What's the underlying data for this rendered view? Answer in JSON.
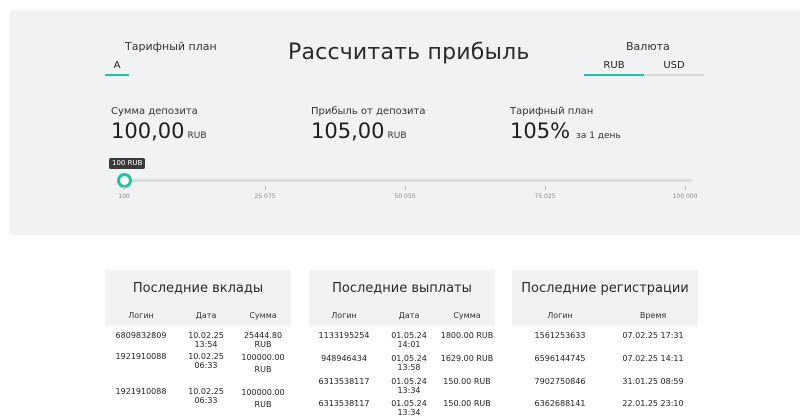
{
  "header": {
    "plan_label": "Тарифный план",
    "plan_tab": "A",
    "title": "Рассчитать прибыль",
    "currency_label": "Валюта",
    "currency_tabs": [
      "RUB",
      "USD"
    ]
  },
  "stats": [
    {
      "label": "Сумма депозита",
      "value": "100,00",
      "unit": "RUB"
    },
    {
      "label": "Прибыль от депозита",
      "value": "105,00",
      "unit": "RUB"
    },
    {
      "label": "Тарифный план",
      "value": "105%",
      "unit": "за 1 день"
    }
  ],
  "slider": {
    "bubble": "100 RUB",
    "level": 0,
    "ticks": [
      "100",
      "25 075",
      "50 050",
      "75 025",
      "100 000"
    ]
  },
  "panels": [
    {
      "title": "Последние вклады",
      "columns": [
        "Логин",
        "Дата",
        "Сумма"
      ],
      "rows": [
        [
          "6809832809",
          "10.02.25 13:54",
          "25444.80 RUB"
        ],
        [
          "1921910088",
          "10.02.25 06:33",
          "100000.00 RUB"
        ],
        [
          "1921910088",
          "10.02.25 06:33",
          "100000.00 RUB"
        ]
      ]
    },
    {
      "title": "Последние выплаты",
      "columns": [
        "Логин",
        "Дата",
        "Сумма"
      ],
      "rows": [
        [
          "1133195254",
          "01.05.24 14:01",
          "1800.00 RUB"
        ],
        [
          "948946434",
          "01.05.24 13:58",
          "1629.00 RUB"
        ],
        [
          "6313538117",
          "01.05.24 13:34",
          "150.00 RUB"
        ],
        [
          "6313538117",
          "01.05.24 13:34",
          "150.00 RUB"
        ]
      ]
    },
    {
      "title": "Последние регистрации",
      "columns": [
        "Логин",
        "Время"
      ],
      "rows": [
        [
          "1561253633",
          "07.02.25 17:31"
        ],
        [
          "6596144745",
          "07.02.25 14:11"
        ],
        [
          "7902750846",
          "31.01.25 08:59"
        ],
        [
          "6362688141",
          "22.01.25 23:10"
        ]
      ]
    }
  ],
  "colors": {
    "accent": "#22c0a6",
    "panel_bg": "#f1f2f3"
  }
}
